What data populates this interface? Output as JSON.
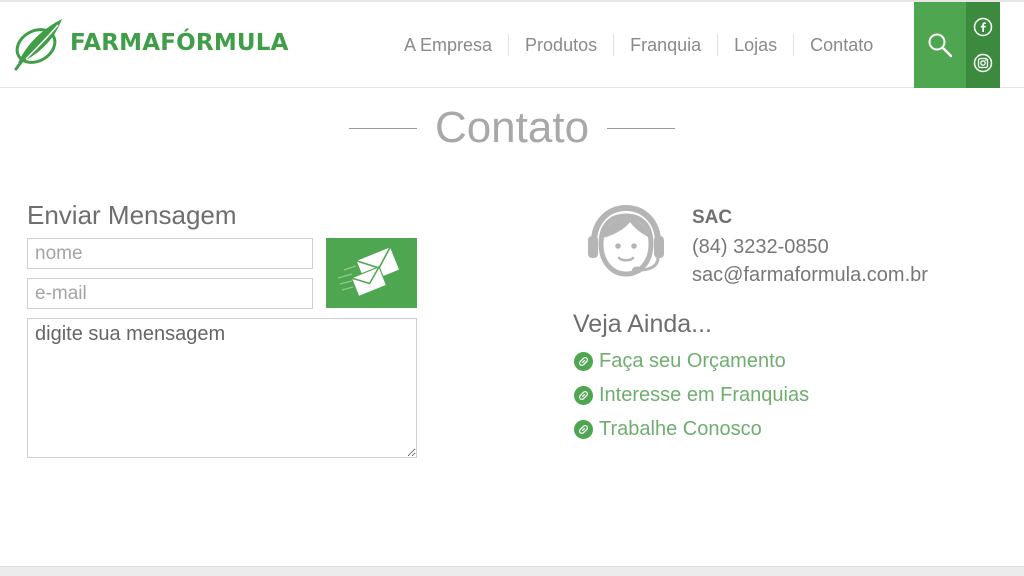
{
  "brand": {
    "name": "FARMAFÓRMULA",
    "color": "#3f9e47"
  },
  "nav": {
    "items": [
      {
        "label": "A Empresa"
      },
      {
        "label": "Produtos"
      },
      {
        "label": "Franquia"
      },
      {
        "label": "Lojas"
      },
      {
        "label": "Contato"
      }
    ],
    "search_icon": "search-icon",
    "social_icons": [
      "facebook-icon",
      "instagram-icon"
    ]
  },
  "page": {
    "title": "Contato"
  },
  "form": {
    "title": "Enviar Mensagem",
    "name_placeholder": "nome",
    "email_placeholder": "e-mail",
    "message_placeholder": "digite sua mensagem",
    "send_icon": "envelopes-icon"
  },
  "sac": {
    "title": "SAC",
    "phone": "(84) 3232-0850",
    "email": "sac@farmaformula.com.br",
    "avatar_icon": "headset-support-icon"
  },
  "veja_ainda": {
    "title": "Veja Ainda...",
    "links": [
      {
        "label": "Faça seu Orçamento"
      },
      {
        "label": "Interesse em Franquias"
      },
      {
        "label": "Trabalhe Conosco"
      }
    ]
  },
  "colors": {
    "accent": "#4fa650",
    "accent_dark": "#3c8a3e",
    "link": "#6fae6f"
  }
}
